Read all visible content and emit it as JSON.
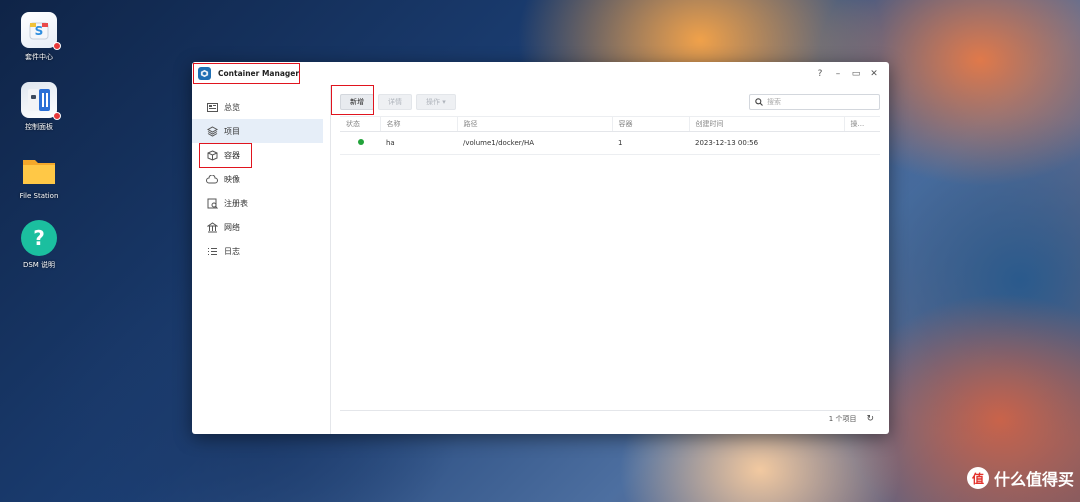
{
  "desktop": {
    "icons": [
      {
        "label": "套件中心",
        "icon": "package-center-icon"
      },
      {
        "label": "控制面板",
        "icon": "control-panel-icon"
      },
      {
        "label": "File Station",
        "icon": "folder-icon"
      },
      {
        "label": "DSM 说明",
        "icon": "help-icon"
      }
    ]
  },
  "window": {
    "title": "Container Manager",
    "controls": {
      "help": "?",
      "minimize": "–",
      "maximize": "▭",
      "close": "✕"
    }
  },
  "sidebar": {
    "items": [
      {
        "label": "总览",
        "icon": "overview-icon"
      },
      {
        "label": "项目",
        "icon": "layers-icon",
        "active": true
      },
      {
        "label": "容器",
        "icon": "cube-icon"
      },
      {
        "label": "映像",
        "icon": "cloud-icon"
      },
      {
        "label": "注册表",
        "icon": "registry-icon"
      },
      {
        "label": "网络",
        "icon": "network-icon"
      },
      {
        "label": "日志",
        "icon": "log-icon"
      }
    ]
  },
  "toolbar": {
    "create_label": "新增",
    "details_label": "详情",
    "action_label": "操作 ▾",
    "search_placeholder": "搜索"
  },
  "table": {
    "columns": [
      "状态",
      "名称",
      "路径",
      "容器",
      "创建时间",
      "操..."
    ],
    "rows": [
      {
        "status": "running",
        "name": "ha",
        "path": "/volume1/docker/HA",
        "containers": "1",
        "created": "2023-12-13 00:56"
      }
    ]
  },
  "footer": {
    "count_label": "1 个项目",
    "refresh": "↻"
  },
  "watermark": {
    "text": "什么值得买",
    "logo": "值"
  },
  "colors": {
    "accent": "#1f6fb4",
    "status_running": "#22a33a",
    "highlight": "#e0141e"
  }
}
